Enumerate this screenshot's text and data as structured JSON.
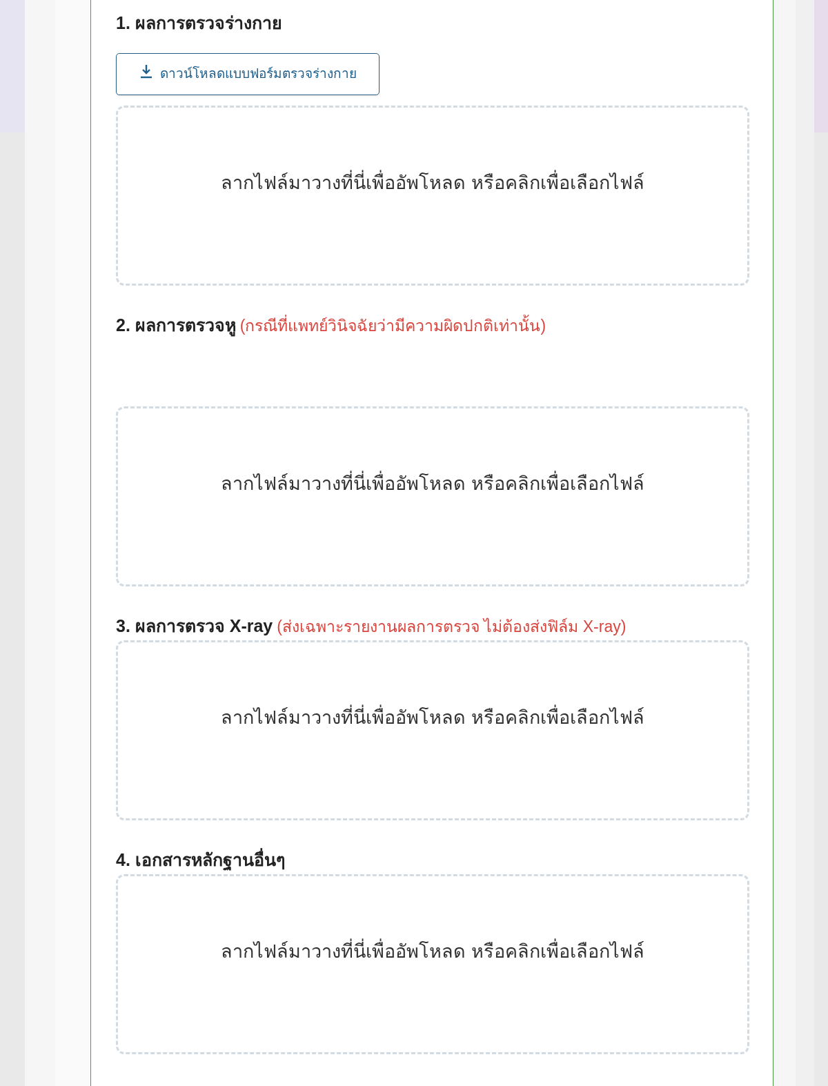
{
  "sections": [
    {
      "title": "1. ผลการตรวจร่างกาย",
      "download_button": "ดาวน์โหลดแบบฟอร์มตรวจร่างกาย",
      "dropzone": "ลากไฟล์มาวางที่นี่เพื่ออัพโหลด หรือคลิกเพื่อเลือกไฟล์"
    },
    {
      "title": "2. ผลการตรวจหู",
      "note": "(กรณีที่แพทย์วินิจฉัยว่ามีความผิดปกติเท่านั้น)",
      "dropzone": "ลากไฟล์มาวางที่นี่เพื่ออัพโหลด หรือคลิกเพื่อเลือกไฟล์"
    },
    {
      "title": "3. ผลการตรวจ X-ray",
      "note": "(ส่งเฉพาะรายงานผลการตรวจ ไม่ต้องส่งฟิล์ม X-ray)",
      "dropzone": "ลากไฟล์มาวางที่นี่เพื่ออัพโหลด หรือคลิกเพื่อเลือกไฟล์"
    },
    {
      "title": "4. เอกสารหลักฐานอื่นๆ",
      "dropzone": "ลากไฟล์มาวางที่นี่เพื่ออัพโหลด หรือคลิกเพื่อเลือกไฟล์"
    }
  ]
}
